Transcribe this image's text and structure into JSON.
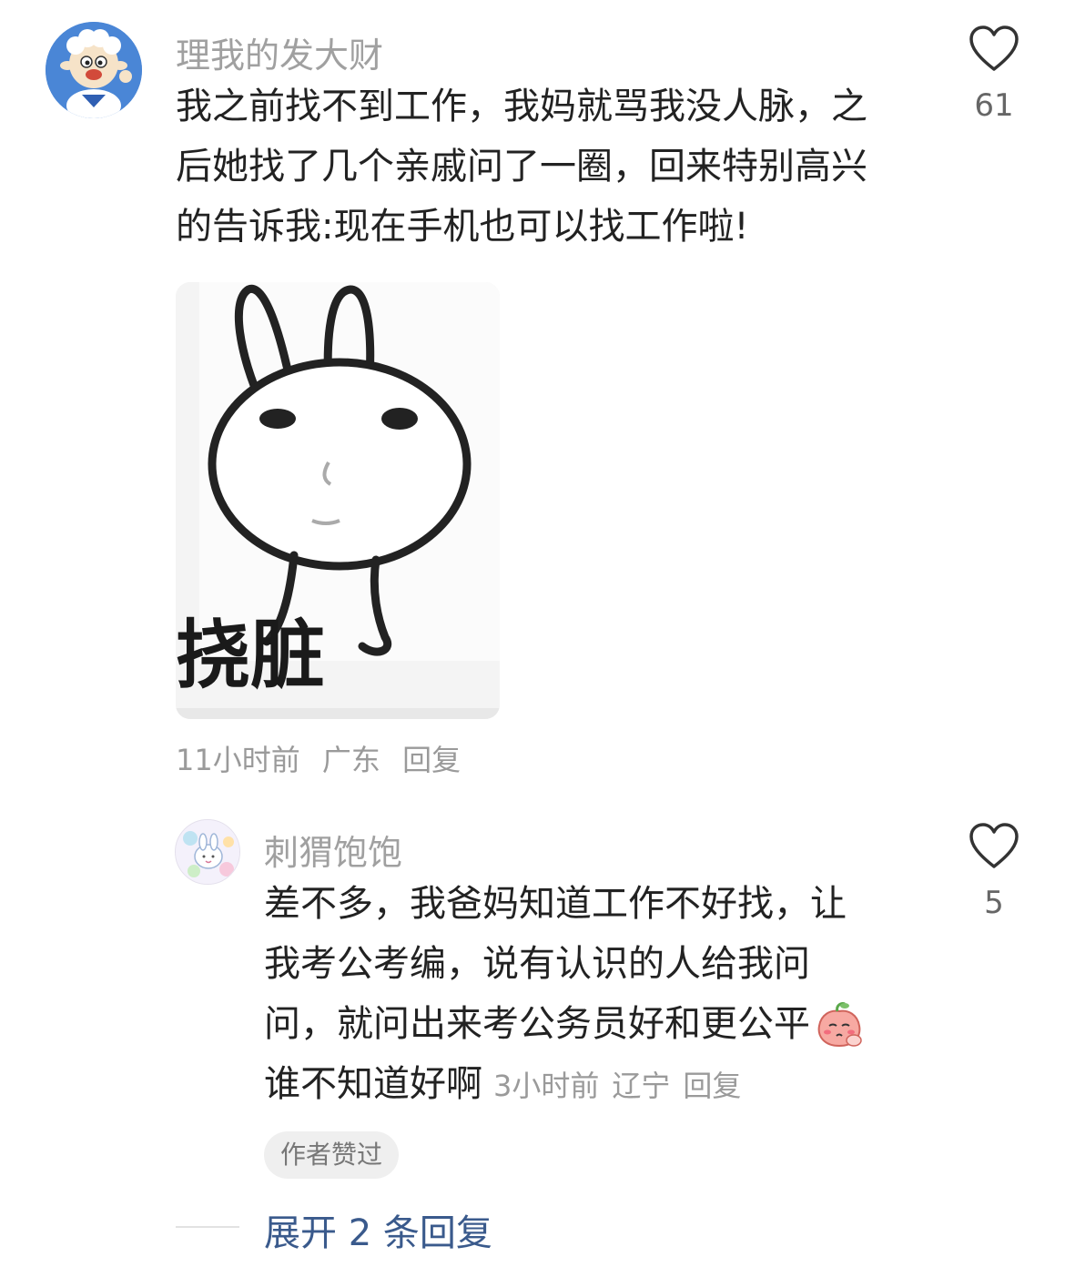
{
  "comments": [
    {
      "username": "理我的发大财",
      "avatar_icon": "cartoon-sheep-avatar",
      "lines": [
        "我之前找不到工作，我妈就骂我没人脉，之",
        "后她找了几个亲戚问了一圈，回来特别高兴",
        "的告诉我:现在手机也可以找工作啦!"
      ],
      "sticker_caption": "挠脏",
      "sticker_icon": "rabbit-meme-sticker",
      "time": "11小时前",
      "location": "广东",
      "reply_label": "回复",
      "like_icon": "heart-icon",
      "like_count": "61"
    },
    {
      "username": "刺猬饱饱",
      "avatar_icon": "pastel-bunny-avatar",
      "lines": [
        "差不多，我爸妈知道工作不好找，让",
        "我考公考编，说有认识的人给我问",
        "问，就问出来考公务员好和更公平"
      ],
      "last_line": "谁不知道好啊",
      "emoji_icon": "thinking-peach-emoji",
      "time": "3小时前",
      "location": "辽宁",
      "reply_label": "回复",
      "like_icon": "heart-icon",
      "like_count": "5",
      "author_badge": "作者赞过"
    }
  ],
  "expand_replies": "展开 2 条回复",
  "colors": {
    "username": "#a0a0a0",
    "body_text": "#222222",
    "meta": "#9a9a9a",
    "link_blue": "#3a5a8c",
    "badge_bg": "#efefef"
  }
}
